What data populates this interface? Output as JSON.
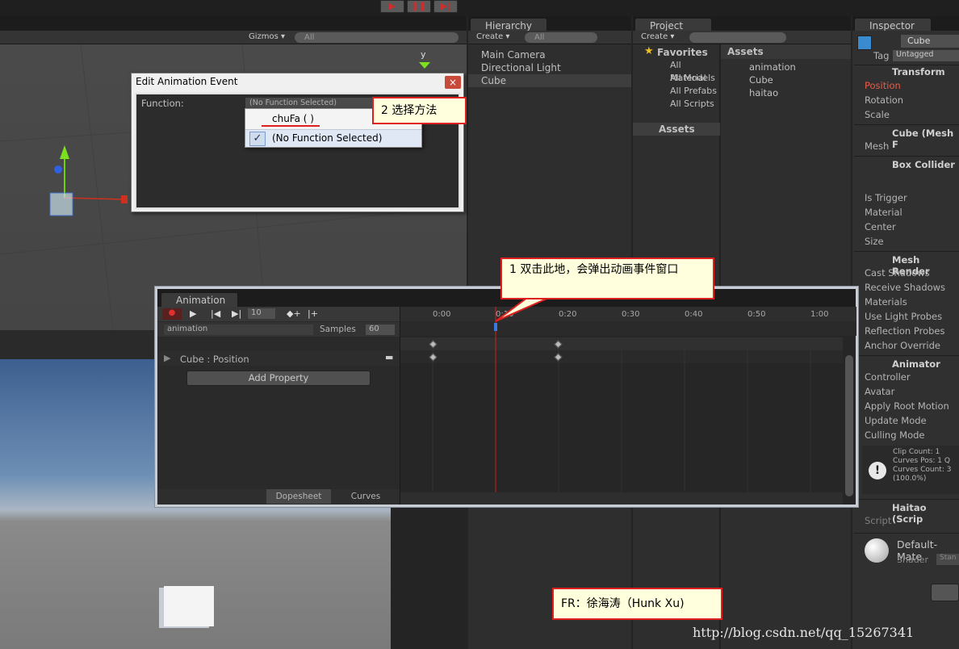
{
  "play_controls": {
    "play": "▶",
    "pause": "❚❚",
    "step": "▶|"
  },
  "scene": {
    "gizmos_label": "Gizmos ▾",
    "search_placeholder": "All",
    "axis_y": "y"
  },
  "hierarchy": {
    "tab": "Hierarchy",
    "create": "Create ▾",
    "search": "All",
    "items": [
      "Main Camera",
      "Directional Light",
      "Cube"
    ]
  },
  "project": {
    "tab": "Project",
    "create": "Create ▾",
    "favorites_label": "Favorites",
    "favorites": [
      "All Material",
      "All Models",
      "All Prefabs",
      "All Scripts"
    ],
    "assets_label": "Assets",
    "assets": [
      "animation",
      "Cube",
      "haitao"
    ]
  },
  "inspector": {
    "tab": "Inspector",
    "object_name": "Cube",
    "tag_label": "Tag",
    "tag_value": "Untagged",
    "transform": {
      "title": "Transform",
      "rows": [
        "Position",
        "Rotation",
        "Scale"
      ]
    },
    "mesh_filter": {
      "title": "Cube (Mesh F",
      "rows": [
        "Mesh"
      ]
    },
    "box_collider": {
      "title": "Box Collider",
      "rows": [
        "Is Trigger",
        "Material",
        "Center",
        "Size"
      ]
    },
    "mesh_renderer": {
      "title": "Mesh Render",
      "rows": [
        "Cast Shadows",
        "Receive Shadows",
        "Materials",
        "Use Light Probes",
        "Reflection Probes",
        "Anchor Override"
      ]
    },
    "animator": {
      "title": "Animator",
      "rows": [
        "Controller",
        "Avatar",
        "Apply Root Motion",
        "Update Mode",
        "Culling Mode"
      ],
      "info": [
        "Clip Count: 1",
        "Curves Pos: 1 Q",
        "Curves Count: 3",
        "(100.0%)"
      ]
    },
    "script": {
      "title": "Haitao (Scrip",
      "rows": [
        "Script"
      ]
    },
    "material": {
      "name": "Default-Mate",
      "shader_label": "Shader",
      "shader_value": "Stan"
    }
  },
  "dialog": {
    "title": "Edit Animation Event",
    "close": "×",
    "function_label": "Function:",
    "function_value": "(No Function Selected)",
    "options": [
      "chuFa ( )",
      "(No Function Selected)"
    ],
    "check": "✓"
  },
  "animation": {
    "tab": "Animation",
    "frame": "10",
    "clip": "animation",
    "samples_label": "Samples",
    "samples_value": "60",
    "property": "Cube : Position",
    "add_property": "Add Property",
    "dopesheet": "Dopesheet",
    "curves": "Curves",
    "ticks": [
      "0:00",
      "0:10",
      "0:20",
      "0:30",
      "0:40",
      "0:50",
      "1:00"
    ]
  },
  "callouts": {
    "step2": "2 选择方法",
    "step1": "1 双击此地，会弹出动画事件窗口",
    "author": "FR：徐海涛（Hunk Xu)"
  },
  "watermark": "http://blog.csdn.net/qq_15267341"
}
